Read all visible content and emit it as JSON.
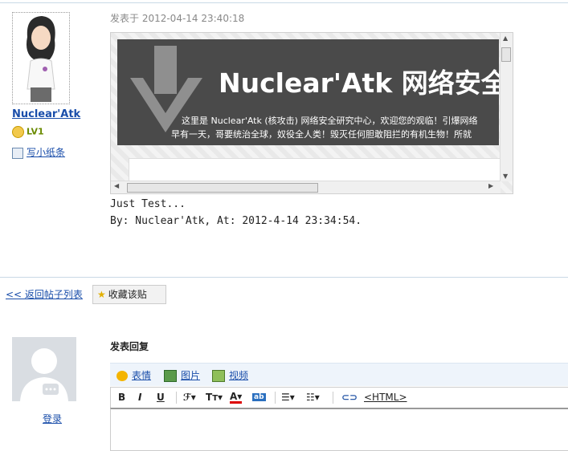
{
  "post": {
    "author": "Nuclear'Atk",
    "level": "LV1",
    "note_link": "写小纸条",
    "time": "发表于 2012-04-14 23:40:18",
    "embed": {
      "title": "Nuclear'Atk 网络安全研",
      "line1": "这里是 Nuclear'Atk (核攻击) 网络安全研究中心，欢迎您的观临！引爆网络",
      "line2": "早有一天，哥要统治全球，奴役全人类！毁灭任何胆敢阻拦的有机生物！所就"
    },
    "message": [
      "Just Test...",
      "By: Nuclear'Atk, At: 2012-4-14 23:34:54."
    ]
  },
  "actions": {
    "back": "<< 返回帖子列表",
    "favorite": "收藏该贴"
  },
  "reply": {
    "login": "登录",
    "title": "发表回复",
    "toolbar": [
      "表情",
      "图片",
      "视频"
    ],
    "format": {
      "bold": "B",
      "italic": "I",
      "underline": "U",
      "html": "<HTML>"
    }
  },
  "colors": {
    "link": "#1a4eaa",
    "toolbar_bg": "#eef4fb",
    "banner_bg": "#4a4a4a"
  }
}
